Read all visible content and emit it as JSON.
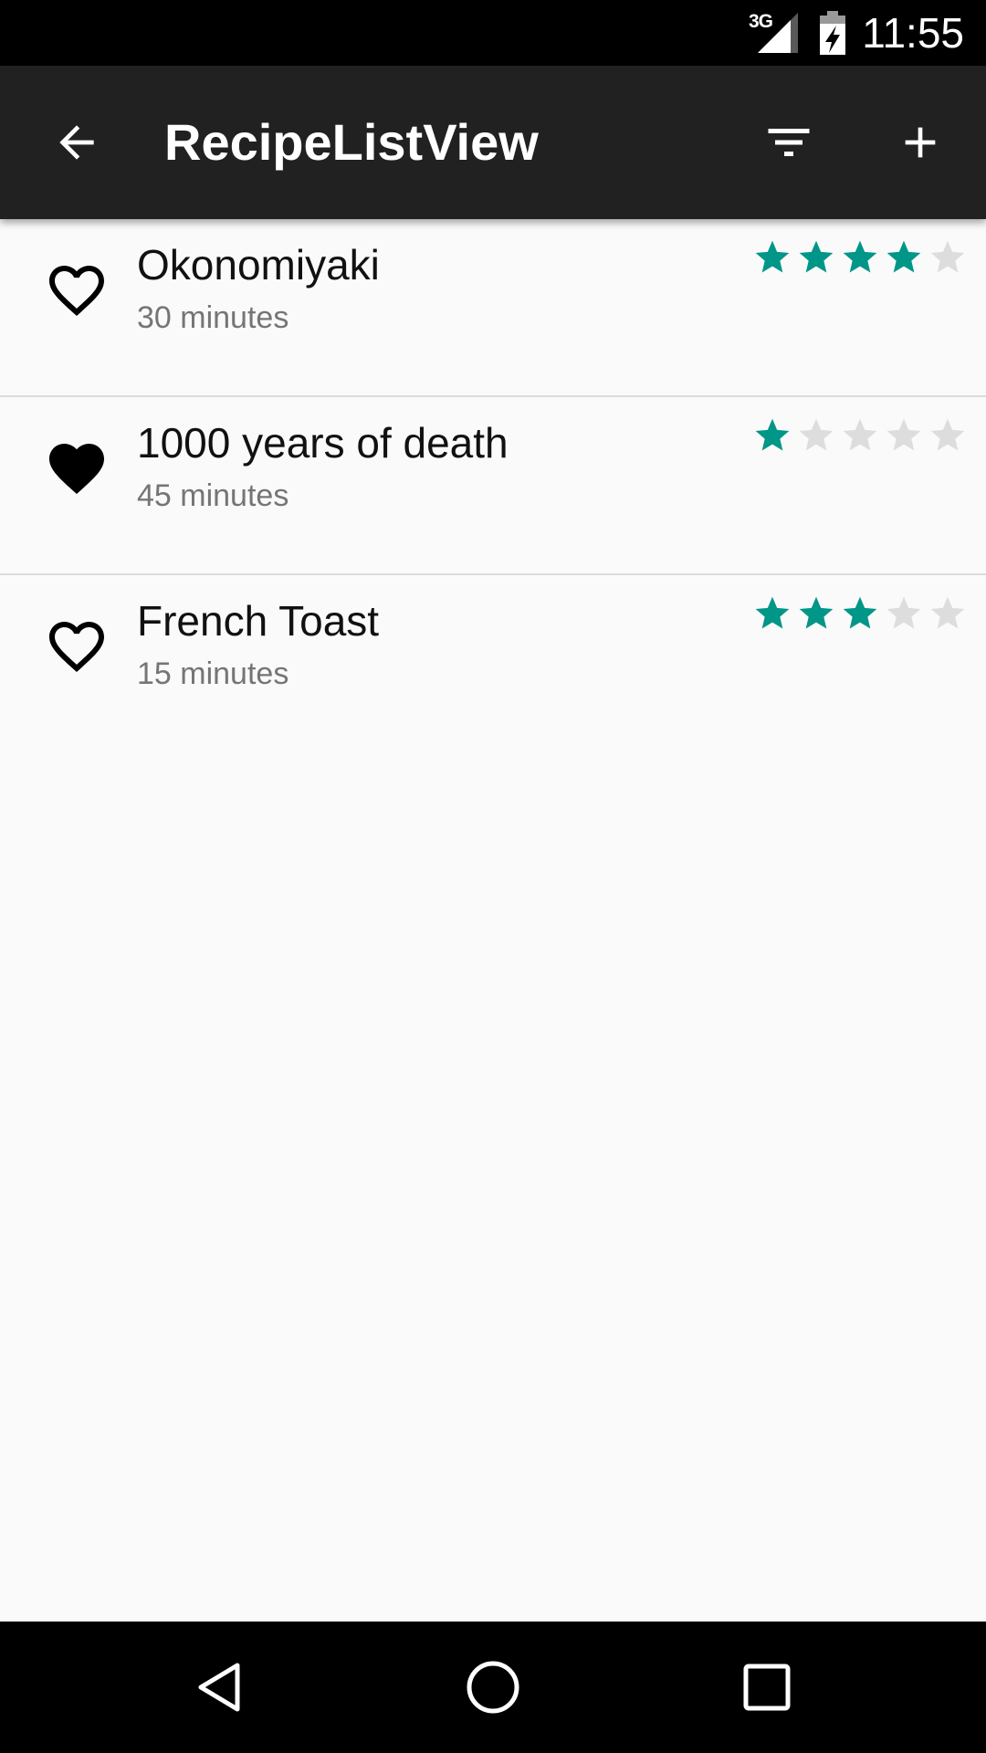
{
  "status_bar": {
    "network": "3G",
    "time": "11:55"
  },
  "toolbar": {
    "title": "RecipeListView",
    "icons": [
      "arrow-back-icon",
      "filter-icon",
      "add-icon"
    ]
  },
  "recipes": [
    {
      "name": "Okonomiyaki",
      "time": "30 minutes",
      "favorite": false,
      "rating": 4,
      "max_rating": 5
    },
    {
      "name": "1000 years of death",
      "time": "45 minutes",
      "favorite": true,
      "rating": 1,
      "max_rating": 5
    },
    {
      "name": "French Toast",
      "time": "15 minutes",
      "favorite": false,
      "rating": 3,
      "max_rating": 5
    }
  ],
  "colors": {
    "toolbar": "#212121",
    "star_filled": "#009688",
    "star_empty": "#dddddd",
    "background": "#fafafa"
  },
  "nav_bar": {
    "icons": [
      "nav-back-icon",
      "nav-home-icon",
      "nav-recents-icon"
    ]
  }
}
